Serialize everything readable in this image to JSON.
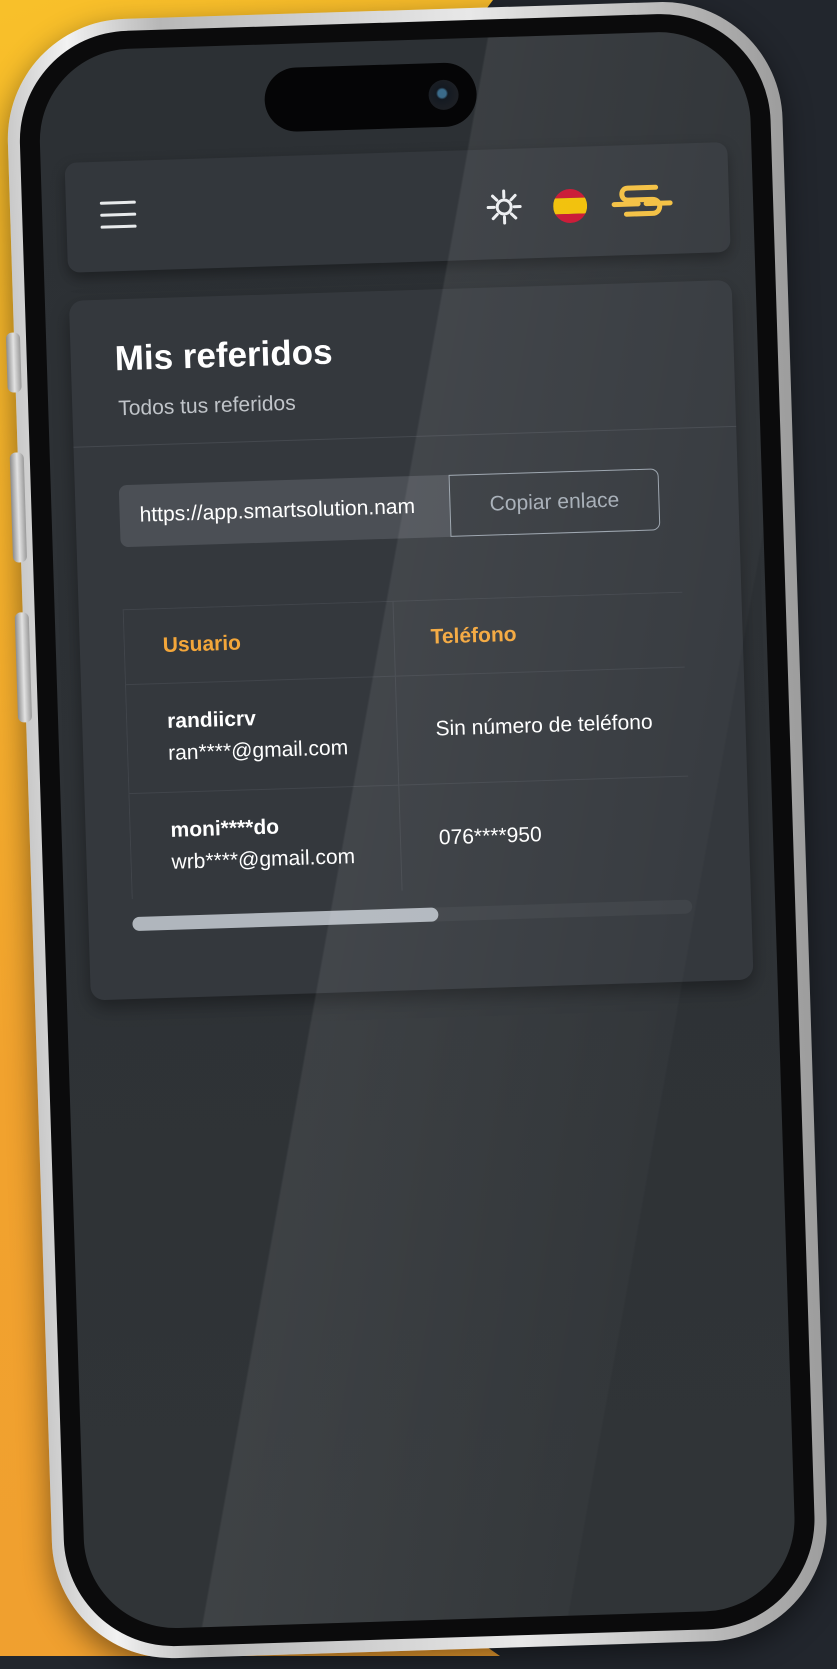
{
  "header": {
    "icons": [
      "menu-icon",
      "sun-icon",
      "spain-flag-icon",
      "smart-solution-logo"
    ]
  },
  "referrals": {
    "title": "Mis referidos",
    "subtitle": "Todos tus referidos",
    "link_value": "https://app.smartsolution.nam",
    "copy_label": "Copiar enlace",
    "columns": [
      "Usuario",
      "Teléfono"
    ],
    "rows": [
      {
        "name": "randiicrv",
        "email": "ran****@gmail.com",
        "phone": "Sin número de teléfono"
      },
      {
        "name": "moni****do",
        "email": "wrb****@gmail.com",
        "phone": "076****950"
      }
    ],
    "scroll_position": 0.55
  },
  "colors": {
    "accent": "#f3a63a",
    "background_orange": "#f1a22e",
    "card": "#34383d"
  }
}
